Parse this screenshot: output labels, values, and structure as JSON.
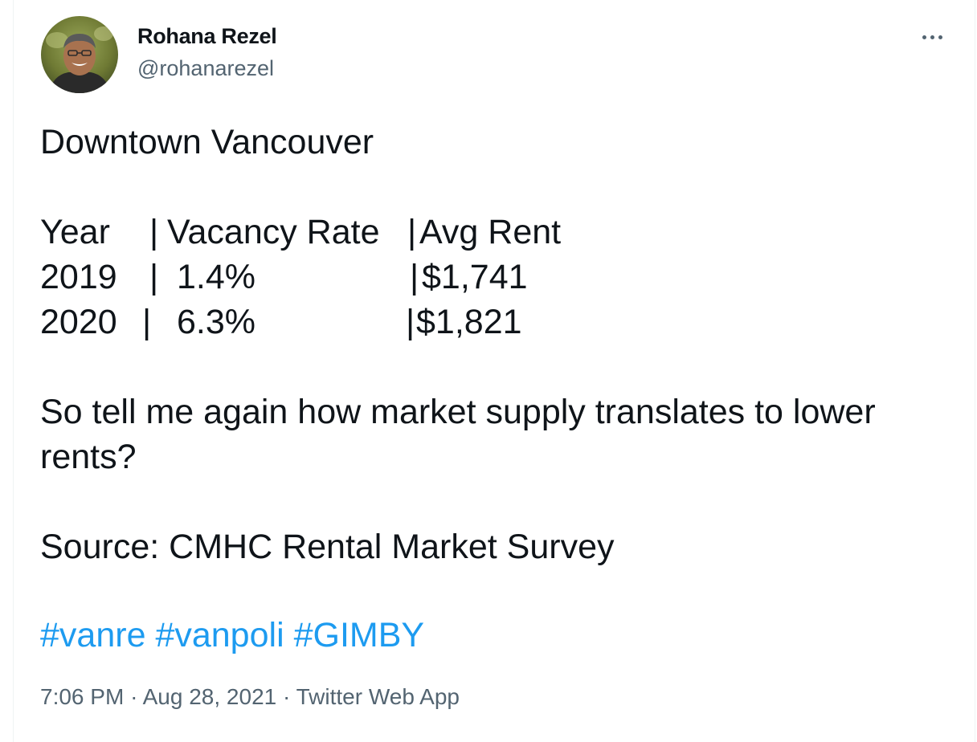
{
  "author": {
    "name": "Rohana Rezel",
    "handle": "@rohanarezel"
  },
  "tweet": {
    "title_line": "Downtown Vancouver",
    "table": {
      "headers": [
        "Year",
        "|",
        "Vacancy Rate",
        "|",
        "Avg Rent"
      ],
      "rows": [
        [
          "2019",
          "|",
          "1.4%",
          "|",
          "$1,741"
        ],
        [
          "2020",
          "|",
          "6.3%",
          "|",
          "$1,821"
        ]
      ]
    },
    "question_line1": "So tell me again how market supply translates to lower",
    "question_line2": "rents?",
    "source_line": "Source: CMHC Rental Market Survey",
    "hashtags": [
      "#vanre",
      "#vanpoli",
      "#GIMBY"
    ]
  },
  "meta": {
    "time": "7:06 PM",
    "separator": "·",
    "date": "Aug 28, 2021",
    "client": "Twitter Web App"
  },
  "colors": {
    "text": "#0f1419",
    "secondary": "#536471",
    "link": "#1d9bf0"
  },
  "icons": {
    "more": "more-horizontal-icon"
  }
}
